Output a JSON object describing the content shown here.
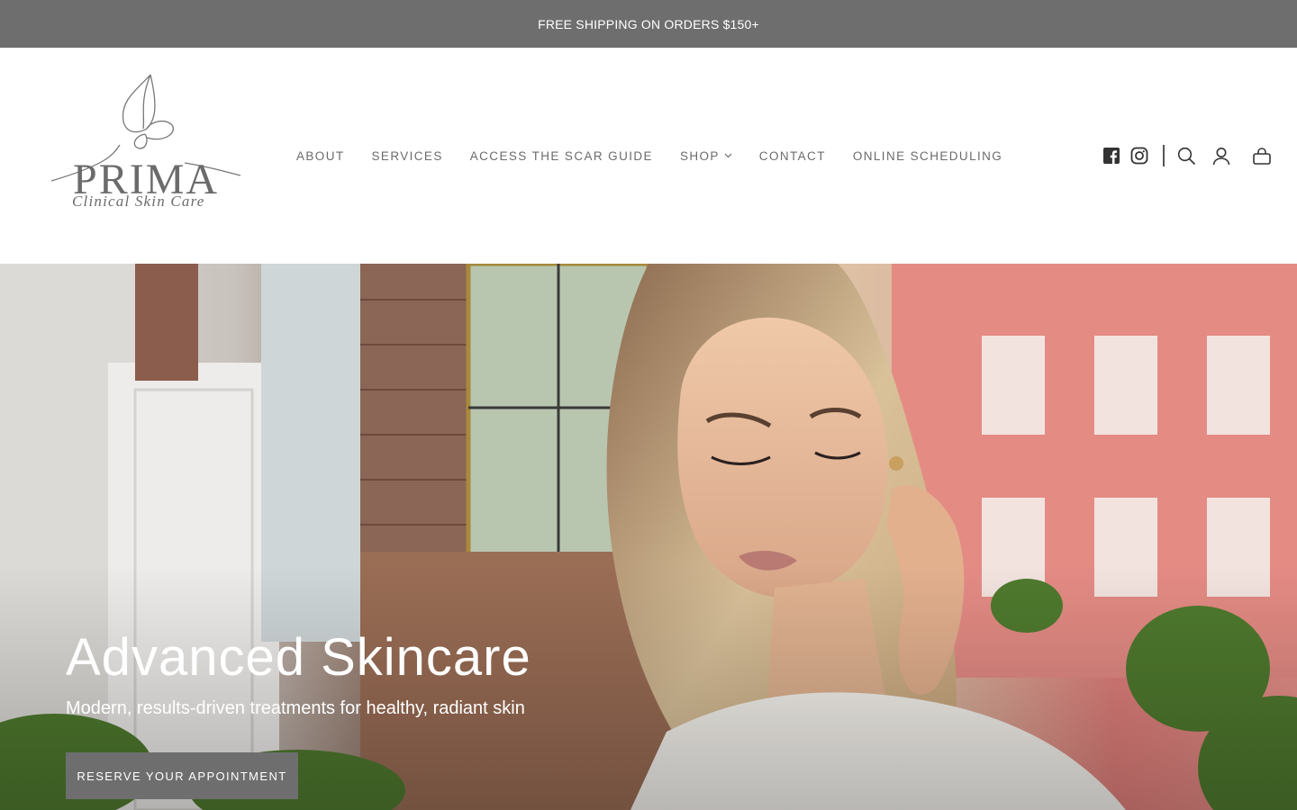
{
  "announcement": {
    "text": "FREE SHIPPING ON ORDERS $150+"
  },
  "logo": {
    "name": "PRIMA",
    "tagline": "Clinical Skin Care"
  },
  "nav": {
    "items": [
      {
        "label": "ABOUT"
      },
      {
        "label": "SERVICES"
      },
      {
        "label": "ACCESS THE SCAR GUIDE"
      },
      {
        "label": "SHOP",
        "has_dropdown": true
      },
      {
        "label": "CONTACT"
      },
      {
        "label": "ONLINE SCHEDULING"
      }
    ]
  },
  "header_icons": [
    "facebook-icon",
    "instagram-icon",
    "search-icon",
    "account-icon",
    "cart-icon"
  ],
  "hero": {
    "title": "Advanced Skincare",
    "subtitle": "Modern, results-driven treatments for healthy, radiant skin",
    "cta_label": "RESERVE YOUR APPOINTMENT"
  },
  "colors": {
    "announcement_bg": "#6e6e6e",
    "nav_text": "#6b6b6b",
    "button_bg": "#6e6e6e",
    "white": "#ffffff"
  }
}
